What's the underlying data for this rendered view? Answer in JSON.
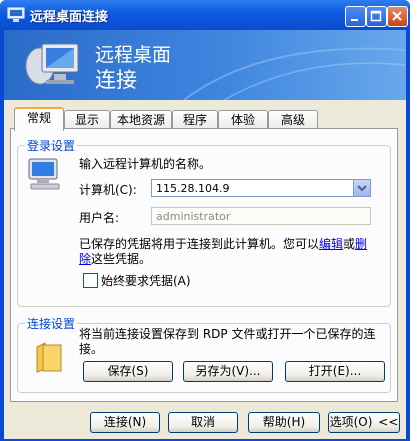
{
  "window": {
    "title": "远程桌面连接"
  },
  "banner": {
    "line1": "远程桌面",
    "line2": "连接"
  },
  "tabs": [
    {
      "label": "常规",
      "active": true
    },
    {
      "label": "显示"
    },
    {
      "label": "本地资源"
    },
    {
      "label": "程序"
    },
    {
      "label": "体验"
    },
    {
      "label": "高级"
    }
  ],
  "login": {
    "group_title": "登录设置",
    "instruction": "输入远程计算机的名称。",
    "computer_label": "计算机(C):",
    "computer_value": "115.28.104.9",
    "username_label": "用户名:",
    "username_value": "administrator",
    "saved_text_a": "已保存的凭据将用于连接到此计算机。您可以",
    "edit_link": "编辑",
    "saved_text_b": "或",
    "delete_link": "删除",
    "saved_text_c": "这些凭据。",
    "always_ask_label": "始终要求凭据(A)",
    "always_ask_checked": false
  },
  "connection": {
    "group_title": "连接设置",
    "description": "将当前连接设置保存到 RDP 文件或打开一个已保存的连接。",
    "save_label": "保存(S)",
    "save_as_label": "另存为(V)...",
    "open_label": "打开(E)..."
  },
  "footer": {
    "connect_label": "连接(N)",
    "cancel_label": "取消",
    "help_label": "帮助(H)",
    "options_label": "选项(O)",
    "options_chevron": "<<"
  },
  "colors": {
    "titlebar": "#0d5ae0",
    "group_title": "#0046d5",
    "dialog_bg": "#ece9d8"
  }
}
